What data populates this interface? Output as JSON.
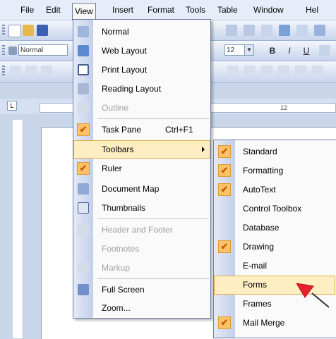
{
  "menubar": {
    "items": [
      {
        "label": "File"
      },
      {
        "label": "Edit"
      },
      {
        "label": "View"
      },
      {
        "label": "Insert"
      },
      {
        "label": "Format"
      },
      {
        "label": "Tools"
      },
      {
        "label": "Table"
      },
      {
        "label": "Window"
      },
      {
        "label": "Hel"
      }
    ]
  },
  "formatting_toolbar": {
    "style_value": "Normal",
    "font_size_value": "12"
  },
  "ruler": {
    "tick_label": "12"
  },
  "view_menu": {
    "items": [
      {
        "label": "Normal",
        "icon": "normal-view-icon"
      },
      {
        "label": "Web Layout",
        "icon": "web-layout-icon"
      },
      {
        "label": "Print Layout",
        "icon": "print-layout-icon"
      },
      {
        "label": "Reading Layout",
        "icon": "reading-layout-icon"
      },
      {
        "label": "Outline",
        "icon": "outline-icon"
      },
      {
        "label": "Task Pane",
        "shortcut": "Ctrl+F1",
        "checked": true
      },
      {
        "label": "Toolbars",
        "submenu": true
      },
      {
        "label": "Ruler",
        "checked": true
      },
      {
        "label": "Document Map",
        "icon": "document-map-icon"
      },
      {
        "label": "Thumbnails",
        "icon": "thumbnails-icon"
      },
      {
        "label": "Header and Footer",
        "icon": "header-footer-icon"
      },
      {
        "label": "Footnotes",
        "icon": "footnotes-icon"
      },
      {
        "label": "Markup",
        "icon": "markup-icon"
      },
      {
        "label": "Full Screen",
        "icon": "full-screen-icon"
      },
      {
        "label": "Zoom...",
        "icon": "zoom-icon"
      }
    ]
  },
  "toolbars_submenu": {
    "items": [
      {
        "label": "Standard",
        "checked": true
      },
      {
        "label": "Formatting",
        "checked": true
      },
      {
        "label": "AutoText",
        "checked": true
      },
      {
        "label": "Control Toolbox",
        "checked": false
      },
      {
        "label": "Database",
        "checked": false
      },
      {
        "label": "Drawing",
        "checked": true
      },
      {
        "label": "E-mail",
        "checked": false
      },
      {
        "label": "Forms",
        "checked": false
      },
      {
        "label": "Frames",
        "checked": false
      },
      {
        "label": "Mail Merge",
        "checked": true
      }
    ]
  },
  "colors": {
    "highlight": "#ffeec2",
    "check_background": "#ffc26a",
    "cursor": "#e8212b"
  }
}
